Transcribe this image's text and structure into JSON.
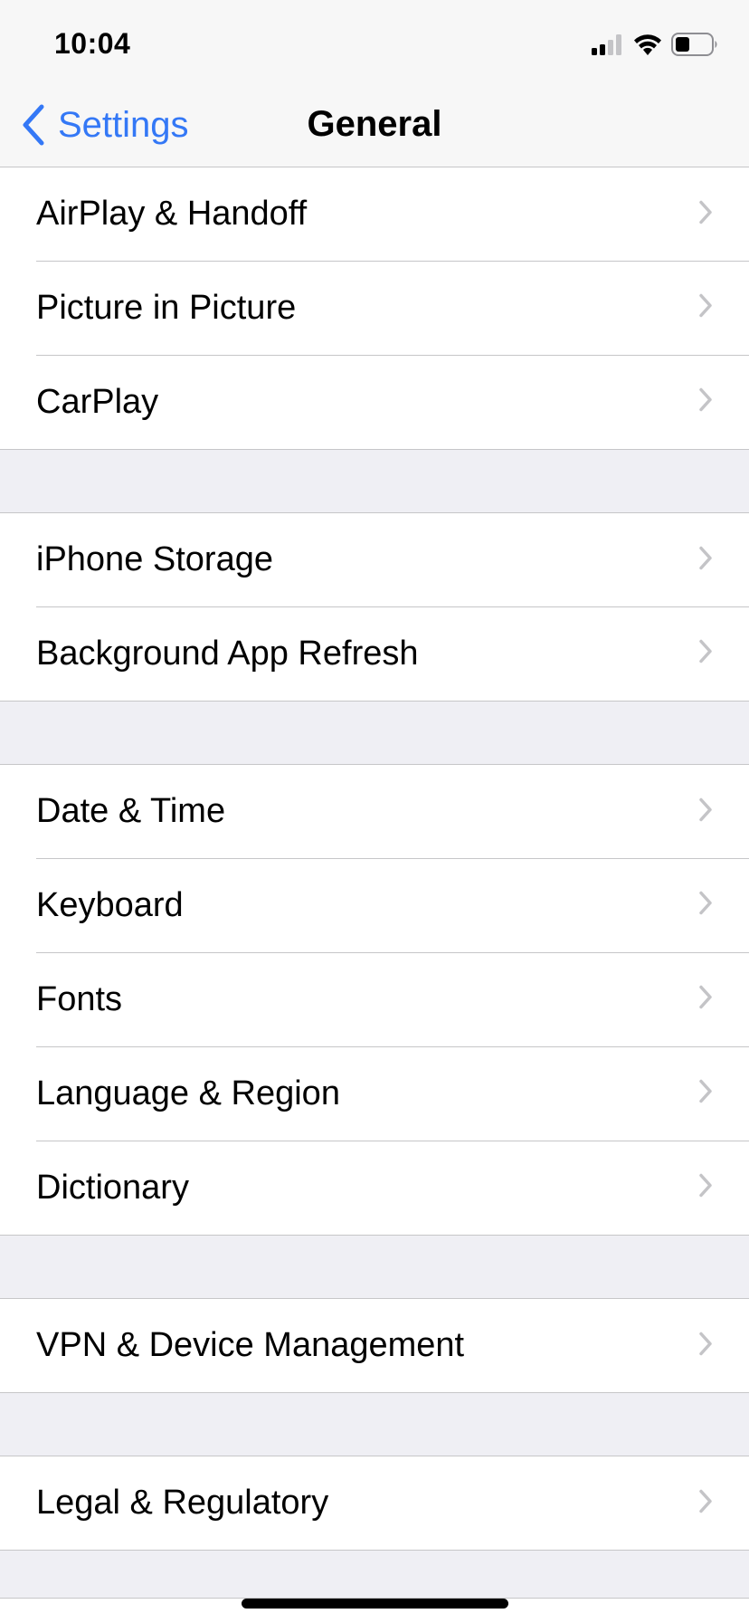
{
  "status_bar": {
    "time": "10:04",
    "signal_icon": "cellular-signal-icon",
    "signal_bars_active": 2,
    "signal_bars_total": 4,
    "wifi_icon": "wifi-icon",
    "battery_icon": "battery-icon",
    "battery_level": 0.35
  },
  "nav": {
    "back_label": "Settings",
    "back_icon": "chevron-left-icon",
    "title": "General"
  },
  "colors": {
    "accent": "#3478f6",
    "background": "#efeff4",
    "separator": "#c6c6c8",
    "chevron": "#c4c4c7"
  },
  "groups": [
    {
      "items": [
        {
          "label": "AirPlay & Handoff"
        },
        {
          "label": "Picture in Picture"
        },
        {
          "label": "CarPlay"
        }
      ]
    },
    {
      "items": [
        {
          "label": "iPhone Storage"
        },
        {
          "label": "Background App Refresh"
        }
      ]
    },
    {
      "items": [
        {
          "label": "Date & Time"
        },
        {
          "label": "Keyboard"
        },
        {
          "label": "Fonts"
        },
        {
          "label": "Language & Region"
        },
        {
          "label": "Dictionary"
        }
      ]
    },
    {
      "items": [
        {
          "label": "VPN & Device Management"
        }
      ]
    },
    {
      "items": [
        {
          "label": "Legal & Regulatory"
        }
      ]
    }
  ]
}
